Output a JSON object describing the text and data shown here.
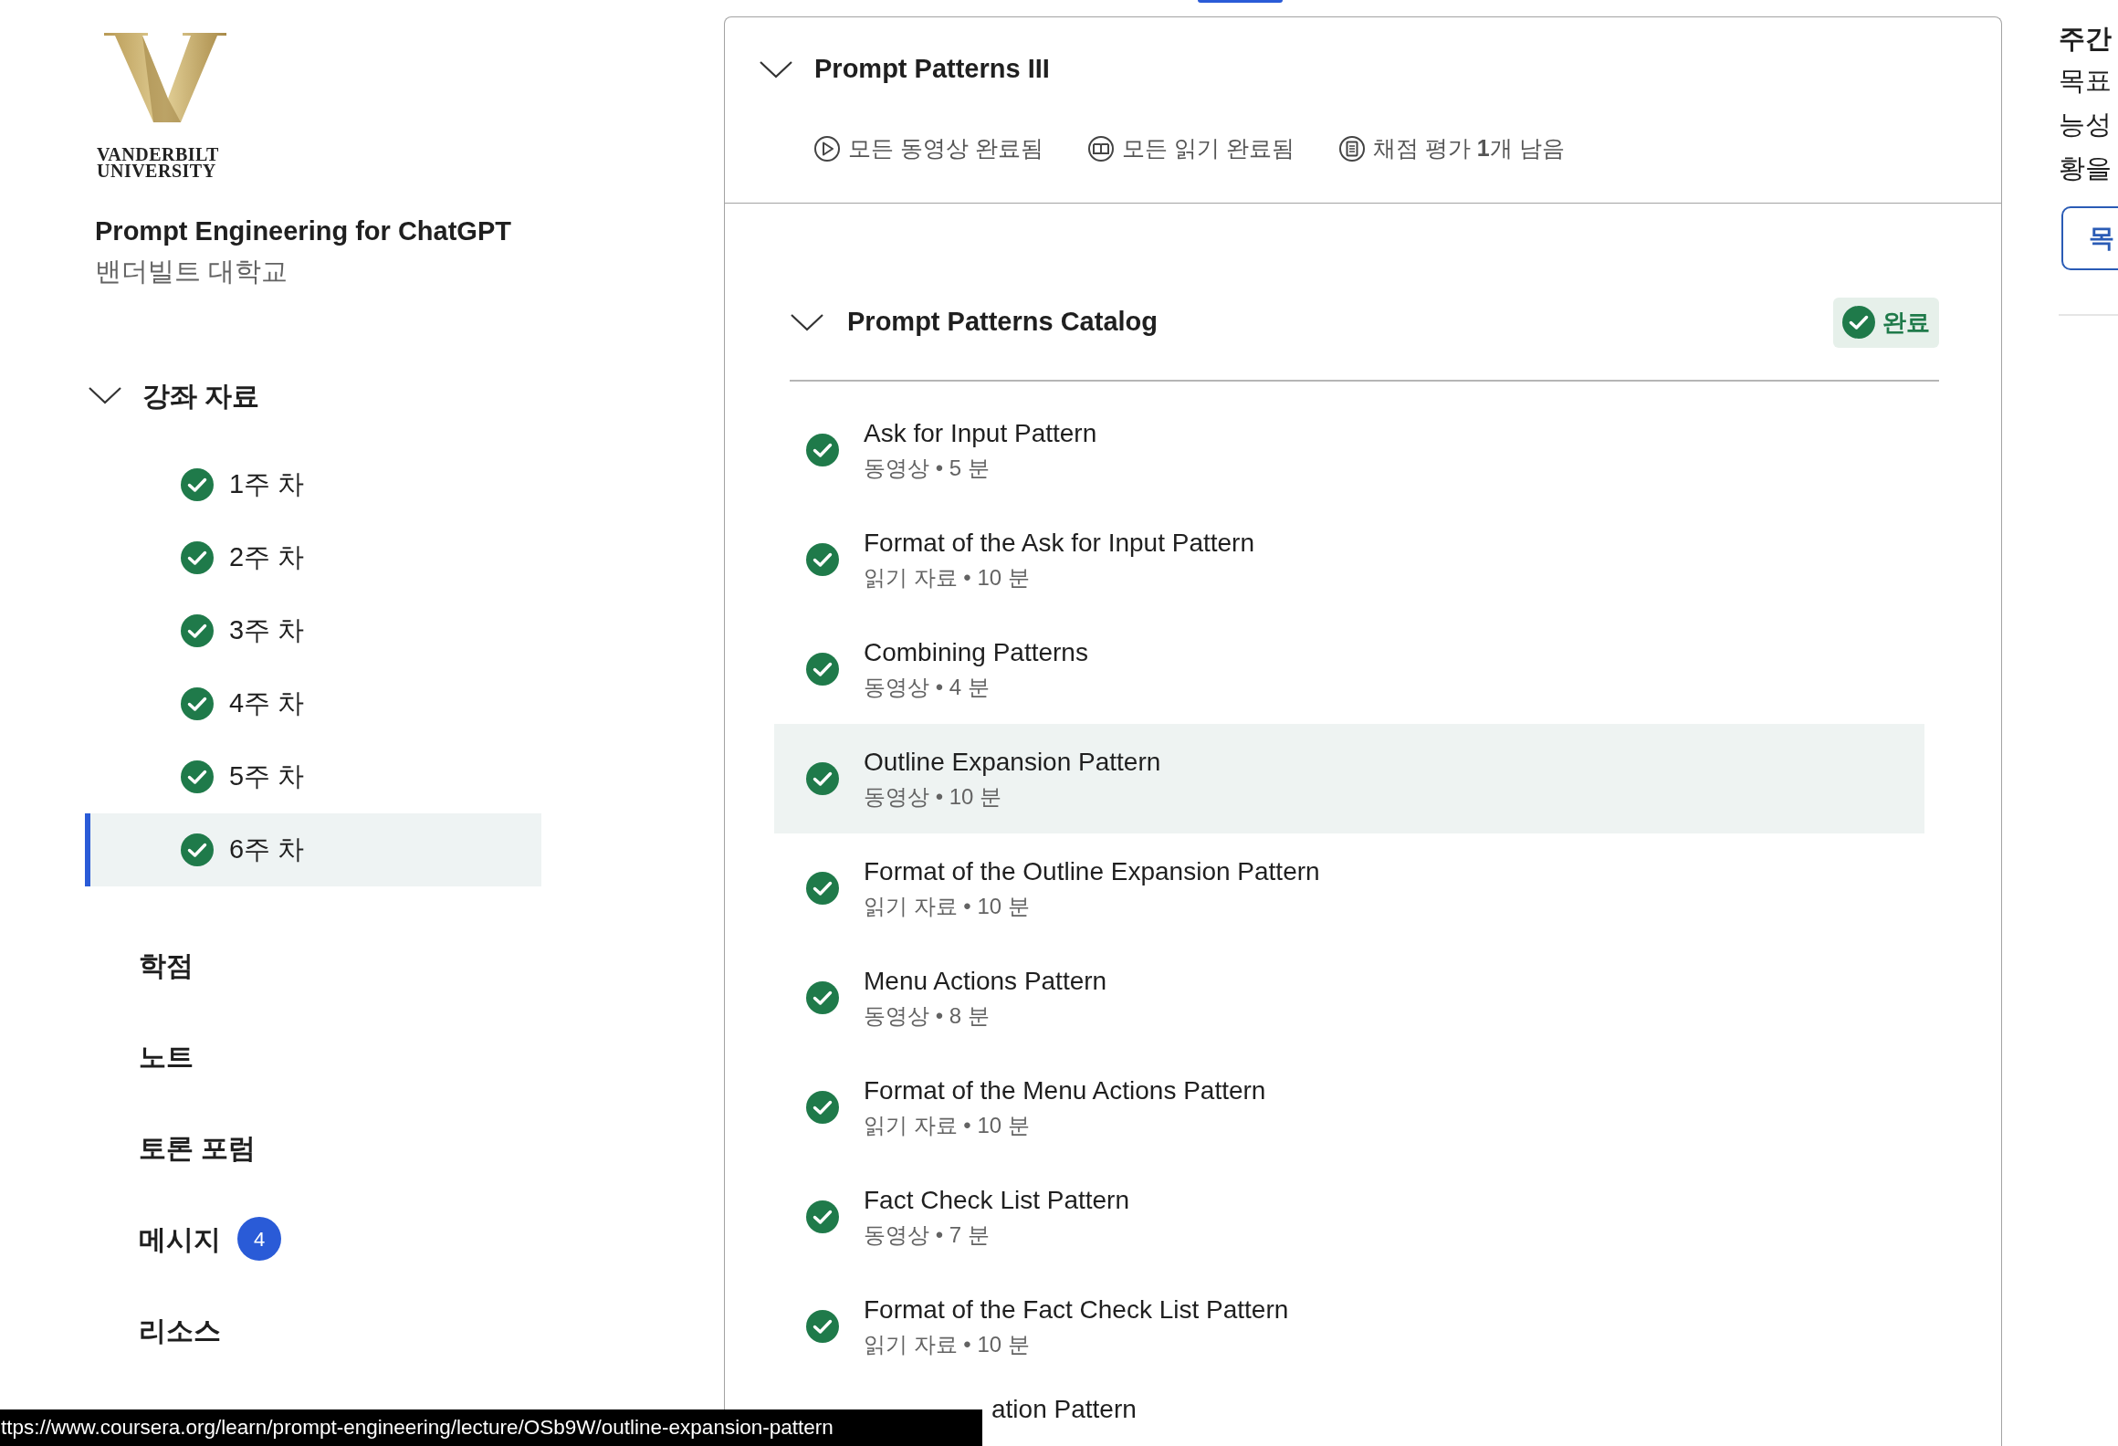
{
  "logo": {
    "wordmark_line_1": "VANDERBILT",
    "wordmark_line_2": "UNIVERSITY"
  },
  "course": {
    "title": "Prompt Engineering for ChatGPT",
    "institution": "밴더빌트 대학교"
  },
  "sidebar": {
    "section": {
      "label": "강좌 자료",
      "expanded": true,
      "weeks": [
        {
          "label": "1주 차",
          "completed": true,
          "selected": false
        },
        {
          "label": "2주 차",
          "completed": true,
          "selected": false
        },
        {
          "label": "3주 차",
          "completed": true,
          "selected": false
        },
        {
          "label": "4주 차",
          "completed": true,
          "selected": false
        },
        {
          "label": "5주 차",
          "completed": true,
          "selected": false
        },
        {
          "label": "6주 차",
          "completed": true,
          "selected": true
        }
      ]
    },
    "links": [
      {
        "label": "학점"
      },
      {
        "label": "노트"
      },
      {
        "label": "토론 포럼"
      },
      {
        "label": "메시지",
        "badge": "4"
      },
      {
        "label": "리소스"
      }
    ]
  },
  "module": {
    "title": "Prompt Patterns III",
    "expanded": true,
    "stats": [
      {
        "kind": "video",
        "text": "모든 동영상 완료됨"
      },
      {
        "kind": "reading",
        "text": "모든 읽기 완료됨"
      },
      {
        "kind": "graded",
        "text": "채점 평가 **1**개 남음"
      }
    ],
    "lesson": {
      "title": "Prompt Patterns Catalog",
      "expanded": true,
      "status": "완료",
      "items": [
        {
          "kind": "lesson",
          "title": "Ask for Input Pattern",
          "meta": "동영상 • 5 분",
          "completed": true,
          "selected": false
        },
        {
          "kind": "lesson",
          "title": "Format of the Ask for Input Pattern",
          "meta": "읽기 자료 • 10 분",
          "completed": true,
          "selected": false
        },
        {
          "kind": "lesson",
          "title": "Combining Patterns",
          "meta": "동영상 • 4 분",
          "completed": true,
          "selected": false
        },
        {
          "kind": "lesson",
          "title": "Outline Expansion Pattern",
          "meta": "동영상 • 10 분",
          "completed": true,
          "selected": true
        },
        {
          "kind": "lesson",
          "title": "Format of the Outline Expansion Pattern",
          "meta": "읽기 자료 • 10 분",
          "completed": true,
          "selected": false
        },
        {
          "kind": "lesson",
          "title": "Menu Actions Pattern",
          "meta": "동영상 • 8 분",
          "completed": true,
          "selected": false
        },
        {
          "kind": "lesson",
          "title": "Format of the Menu Actions Pattern",
          "meta": "읽기 자료 • 10 분",
          "completed": true,
          "selected": false
        },
        {
          "kind": "lesson",
          "title": "Fact Check List Pattern",
          "meta": "동영상 • 7 분",
          "completed": true,
          "selected": false
        },
        {
          "kind": "lesson",
          "title": "Format of the Fact Check List Pattern",
          "meta": "읽기 자료 • 10 분",
          "completed": true,
          "selected": false
        },
        {
          "kind": "partial",
          "title": "ation Pattern"
        }
      ]
    }
  },
  "right_panel": {
    "heading": "주간",
    "lines": [
      "목표",
      "능성",
      "황을"
    ],
    "button": "목"
  },
  "status_url": "ttps://www.coursera.org/learn/prompt-engineering/lecture/OSb9W/outline-expansion-pattern"
}
